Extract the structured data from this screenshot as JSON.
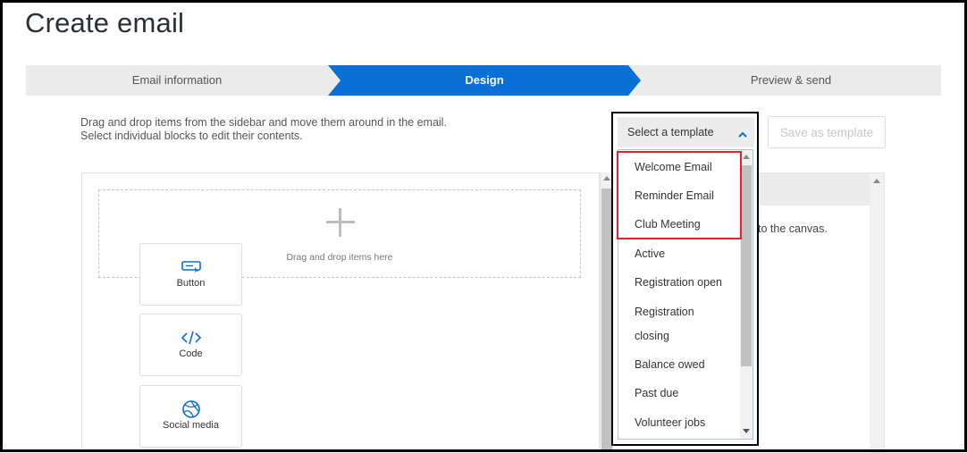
{
  "page": {
    "title": "Create email"
  },
  "stepper": {
    "steps": [
      {
        "label": "Email information",
        "active": false
      },
      {
        "label": "Design",
        "active": true
      },
      {
        "label": "Preview & send",
        "active": false
      }
    ],
    "active_color": "#0a6fd6"
  },
  "instructions": {
    "line1": "Drag and drop items from the sidebar and move them around in the email.",
    "line2": "Select individual blocks to edit their contents."
  },
  "canvas": {
    "drop_label": "Drag and drop items here"
  },
  "template_select": {
    "label": "Select a template",
    "expanded": true,
    "options": [
      "Welcome Email",
      "Reminder Email",
      "Club Meeting",
      "Active",
      "Registration open",
      "Registration",
      "closing",
      "Balance owed",
      "Past due",
      "Volunteer jobs"
    ],
    "highlighted_options": [
      "Welcome Email",
      "Reminder Email",
      "Club Meeting"
    ],
    "highlight_color": "#e0232b"
  },
  "toolbar": {
    "save_template_label": "Save as template"
  },
  "sidebar": {
    "hint": "to the canvas.",
    "blocks": [
      {
        "label": "Button",
        "icon": "button-icon"
      },
      {
        "label": "Code",
        "icon": "code-icon"
      },
      {
        "label": "Social media",
        "icon": "globe-icon"
      }
    ],
    "icon_color": "#0a6fd6"
  }
}
